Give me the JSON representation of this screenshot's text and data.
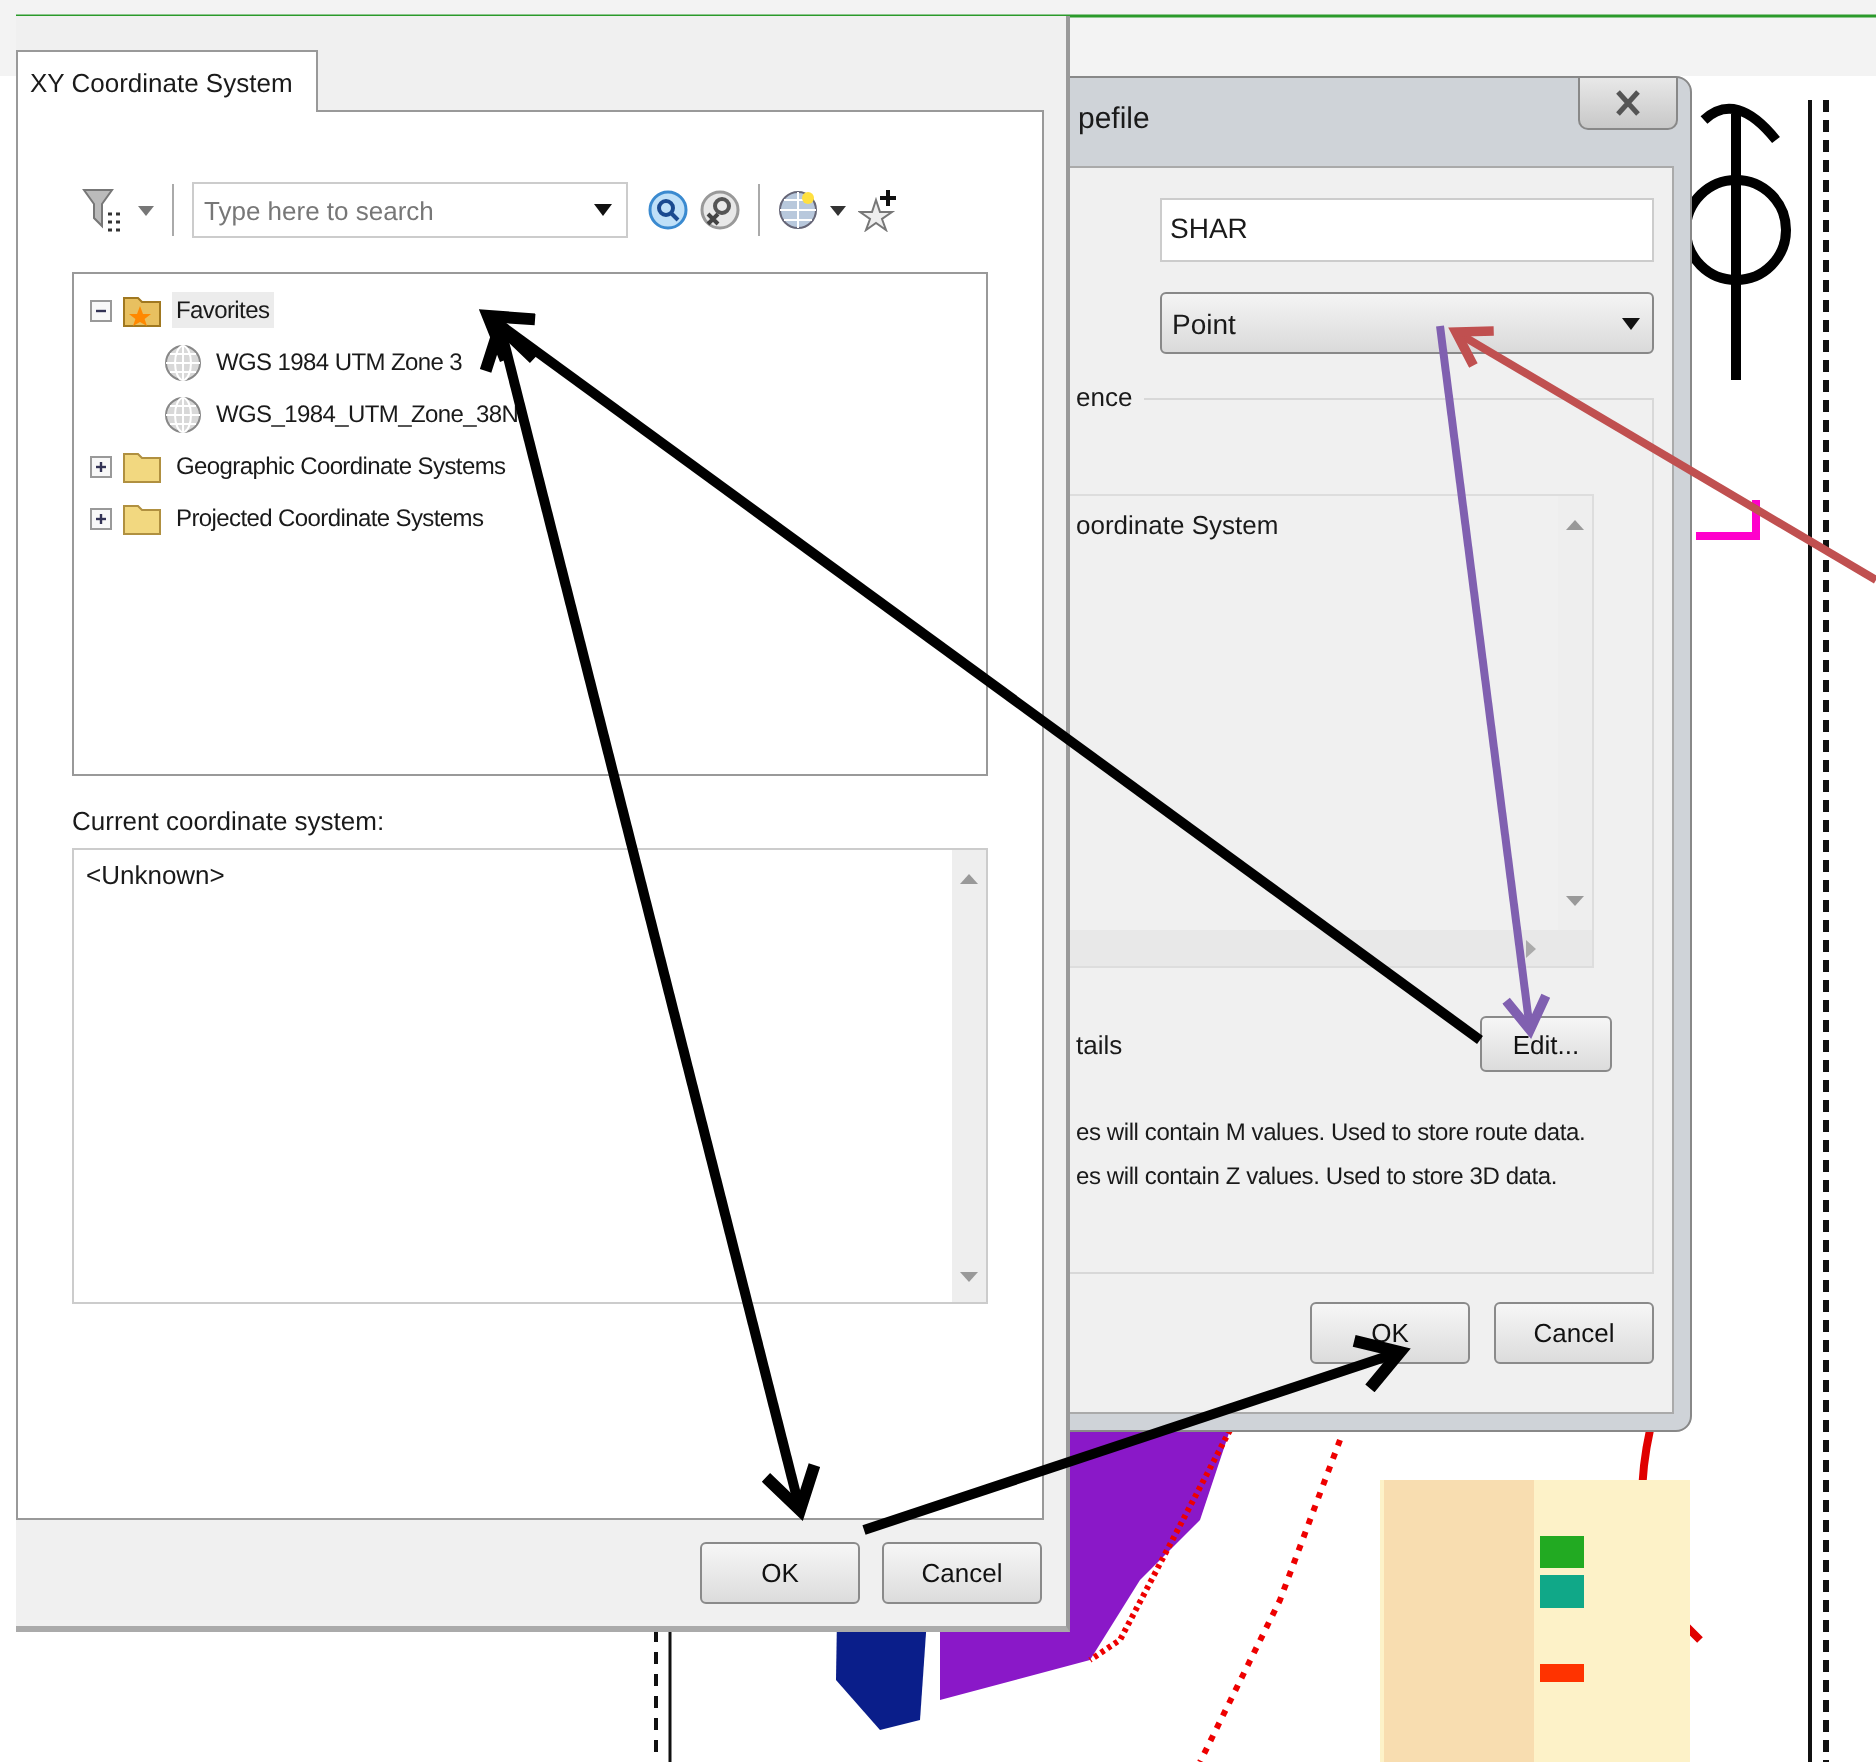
{
  "xy_dialog": {
    "tab": {
      "label": "XY Coordinate System",
      "selected": true
    },
    "search": {
      "placeholder": "Type here to search"
    },
    "tree": [
      {
        "label": "Favorites",
        "kind": "favorites",
        "expanded": true,
        "selected": true,
        "children": [
          {
            "label": "WGS 1984 UTM Zone 3",
            "kind": "crs",
            "selected": false
          },
          {
            "label": "WGS_1984_UTM_Zone_38N",
            "kind": "crs",
            "selected": false
          }
        ]
      },
      {
        "label": "Geographic Coordinate Systems",
        "kind": "folder",
        "expanded": false,
        "selected": false
      },
      {
        "label": "Projected Coordinate Systems",
        "kind": "folder",
        "expanded": false,
        "selected": false
      }
    ],
    "current_label": "Current coordinate system:",
    "current_value": "<Unknown>",
    "buttons": [
      "OK",
      "Cancel"
    ]
  },
  "shapefile_dialog": {
    "title": "pefile",
    "name": "SHAR",
    "feature_type": "Point",
    "group_label": "ence",
    "description": "oordinate System",
    "details_label": "tails",
    "edit_button": "Edit...",
    "options": [
      "es will contain M values. Used to store route data.",
      "es will contain Z values. Used to store 3D data."
    ],
    "buttons": [
      "OK",
      "Cancel"
    ]
  }
}
